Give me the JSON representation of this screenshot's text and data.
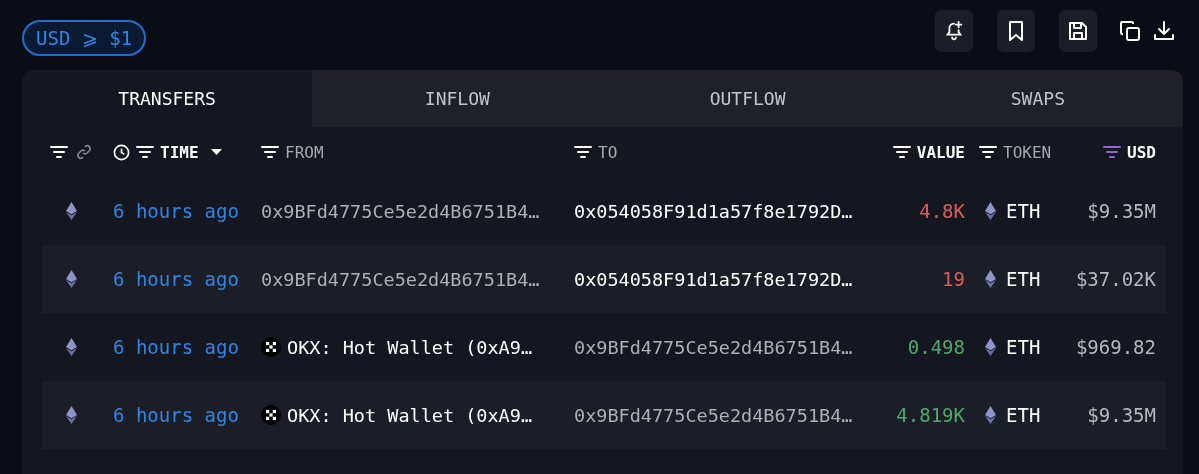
{
  "filter_pill": {
    "label": "USD ⩾ $1"
  },
  "tabs": [
    {
      "label": "TRANSFERS",
      "selected": true
    },
    {
      "label": "INFLOW",
      "selected": false
    },
    {
      "label": "OUTFLOW",
      "selected": false
    },
    {
      "label": "SWAPS",
      "selected": false
    }
  ],
  "columns": [
    {
      "kind": "link"
    },
    {
      "kind": "time",
      "label": "TIME",
      "active": true,
      "filtered": false
    },
    {
      "kind": "from",
      "label": "FROM",
      "active": false,
      "filtered": false
    },
    {
      "kind": "to",
      "label": "TO",
      "active": false,
      "filtered": false
    },
    {
      "kind": "value",
      "label": "VALUE",
      "active": true,
      "filtered": false
    },
    {
      "kind": "token",
      "label": "TOKEN",
      "active": false,
      "filtered": false
    },
    {
      "kind": "usd",
      "label": "USD",
      "active": true,
      "filtered": true
    }
  ],
  "rows": [
    {
      "time": "6 hours ago",
      "from": {
        "text": "0x9BFd4775Ce5e2d4B6751B4…",
        "kind": "address",
        "highlight": false
      },
      "to": {
        "text": "0x054058F91d1a57f8e1792D…",
        "kind": "address",
        "highlight": true
      },
      "value": "4.8K",
      "color": "#e05c5c",
      "token": "ETH",
      "usd": "$9.35M"
    },
    {
      "time": "6 hours ago",
      "from": {
        "text": "0x9BFd4775Ce5e2d4B6751B4…",
        "kind": "address",
        "highlight": false
      },
      "to": {
        "text": "0x054058F91d1a57f8e1792D…",
        "kind": "address",
        "highlight": true
      },
      "value": "19",
      "color": "#e05c5c",
      "token": "ETH",
      "usd": "$37.02K"
    },
    {
      "time": "6 hours ago",
      "from": {
        "text": "OKX: Hot Wallet (0xA9…",
        "kind": "entity",
        "highlight": true
      },
      "to": {
        "text": "0x9BFd4775Ce5e2d4B6751B4…",
        "kind": "address",
        "highlight": false
      },
      "value": "0.498",
      "color": "#4eaa6a",
      "token": "ETH",
      "usd": "$969.82"
    },
    {
      "time": "6 hours ago",
      "from": {
        "text": "OKX: Hot Wallet (0xA9…",
        "kind": "entity",
        "highlight": true
      },
      "to": {
        "text": "0x9BFd4775Ce5e2d4B6751B4…",
        "kind": "address",
        "highlight": false
      },
      "value": "4.819K",
      "color": "#4eaa6a",
      "token": "ETH",
      "usd": "$9.35M"
    }
  ]
}
